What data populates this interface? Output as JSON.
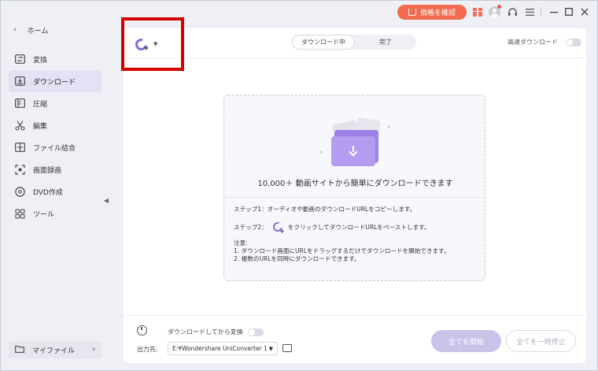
{
  "titlebar": {
    "price_label": "価格を確認"
  },
  "sidebar": {
    "back_label": "ホーム",
    "items": [
      {
        "label": "変換",
        "icon": "convert-icon"
      },
      {
        "label": "ダウンロード",
        "icon": "download-icon"
      },
      {
        "label": "圧縮",
        "icon": "compress-icon"
      },
      {
        "label": "編集",
        "icon": "scissors-icon"
      },
      {
        "label": "ファイル結合",
        "icon": "merge-icon"
      },
      {
        "label": "画面録画",
        "icon": "screen-record-icon"
      },
      {
        "label": "DVD作成",
        "icon": "disc-icon"
      },
      {
        "label": "ツール",
        "icon": "tools-icon"
      }
    ],
    "active_item": "ダウンロード",
    "my_files_label": "マイファイル"
  },
  "main": {
    "tabs": [
      {
        "label": "ダウンロード中",
        "active": true
      },
      {
        "label": "完了",
        "active": false
      }
    ],
    "high_speed_label": "高速ダウンロード",
    "high_speed_enabled": false
  },
  "dropzone": {
    "title": "10,000＋ 動画サイトから簡単にダウンロードできます",
    "step1": "ステップ1：オーディオや動画のダウンロードURLをコピーします。",
    "step2_prefix": "ステップ2：",
    "step2_suffix": "をクリックしてダウンロードURLをペーストします。",
    "note_title": "注意:",
    "note1": "1. ダウンロード画面にURLをドラッグするだけでダウンロードを開始できます。",
    "note2": "2. 複数のURLを同時にダウンロードできます。"
  },
  "footer": {
    "convert_after_label": "ダウンロードしてから変換",
    "convert_after_enabled": false,
    "output_label": "出力先:",
    "output_path": "E:¥Wondershare UniConverter 1",
    "start_all_label": "全てを開始",
    "pause_all_label": "全てを一時停止"
  },
  "colors": {
    "accent": "#8b68e0",
    "price_button": "#f26b4f",
    "highlight_box": "#d40000"
  }
}
